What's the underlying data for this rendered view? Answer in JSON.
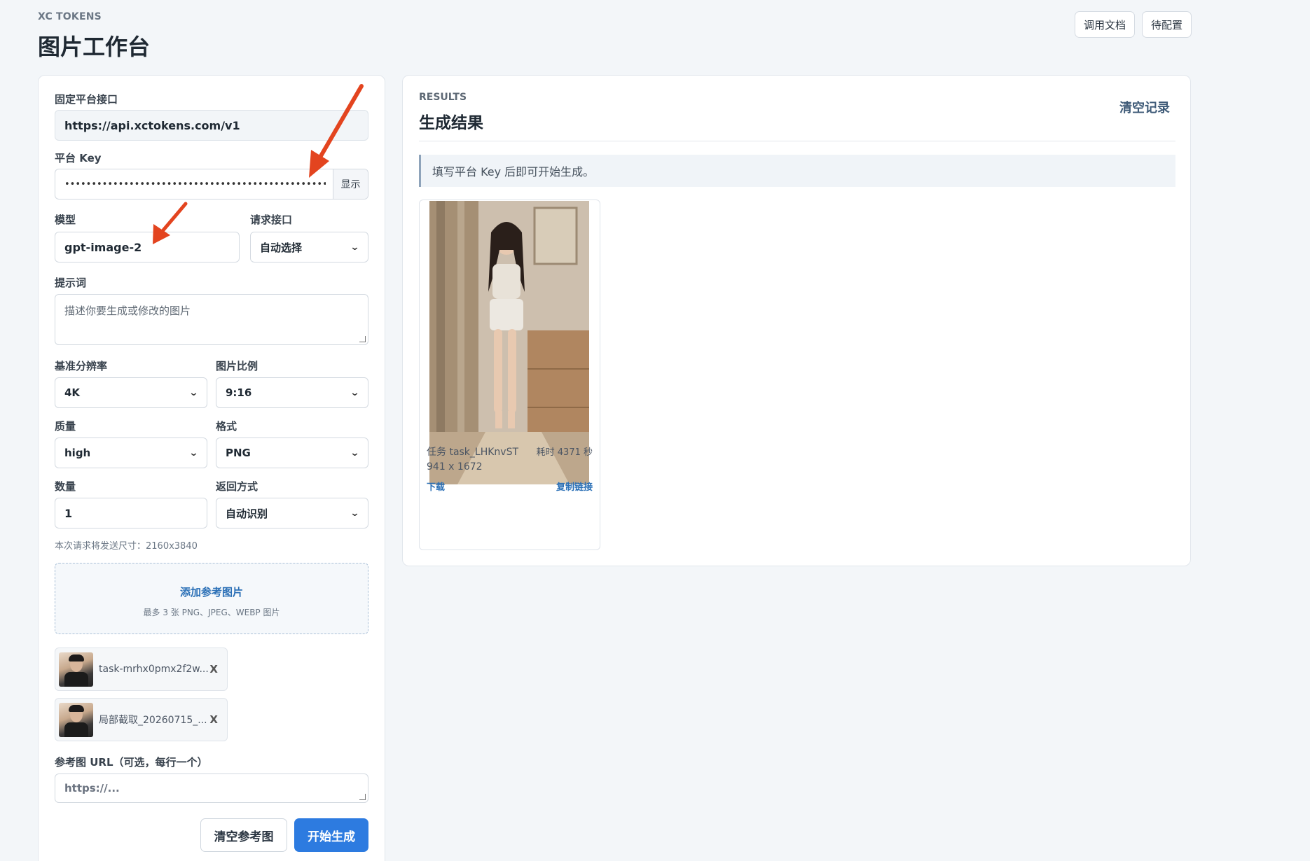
{
  "header": {
    "brand": "XC TOKENS",
    "title": "图片工作台",
    "docs_button": "调用文档",
    "config_button": "待配置"
  },
  "form": {
    "endpoint_label": "固定平台接口",
    "endpoint_value": "https://api.xctokens.com/v1",
    "key_label": "平台 Key",
    "key_value": "•••••••••••••••••••••••••••••••••••••••••••••••••••",
    "key_show": "显示",
    "model_label": "模型",
    "model_value": "gpt-image-2",
    "request_label": "请求接口",
    "request_value": "自动选择",
    "prompt_label": "提示词",
    "prompt_placeholder": "描述你要生成或修改的图片",
    "resolution_label": "基准分辨率",
    "resolution_value": "4K",
    "ratio_label": "图片比例",
    "ratio_value": "9:16",
    "quality_label": "质量",
    "quality_value": "high",
    "format_label": "格式",
    "format_value": "PNG",
    "count_label": "数量",
    "count_value": "1",
    "return_label": "返回方式",
    "return_value": "自动识别",
    "size_hint": "本次请求将发送尺寸：2160x3840",
    "upload_title": "添加参考图片",
    "upload_sub": "最多 3 张 PNG、JPEG、WEBP 图片",
    "ref_images": [
      {
        "name": "task-mrhx0pmx2f2w..."
      },
      {
        "name": "局部截取_20260715_..."
      }
    ],
    "ref_remove": "X",
    "ref_url_label": "参考图 URL（可选，每行一个）",
    "ref_url_placeholder": "https://...",
    "clear_refs_button": "清空参考图",
    "generate_button": "开始生成"
  },
  "results": {
    "eyebrow": "RESULTS",
    "title": "生成结果",
    "clear_button": "清空记录",
    "notice": "填写平台 Key 后即可开始生成。",
    "cards": [
      {
        "task": "任务 task_LHKnvST",
        "duration": "耗时 4371 秒",
        "dimensions": "941 x 1672",
        "download": "下载",
        "copy_link": "复制链接"
      }
    ]
  }
}
